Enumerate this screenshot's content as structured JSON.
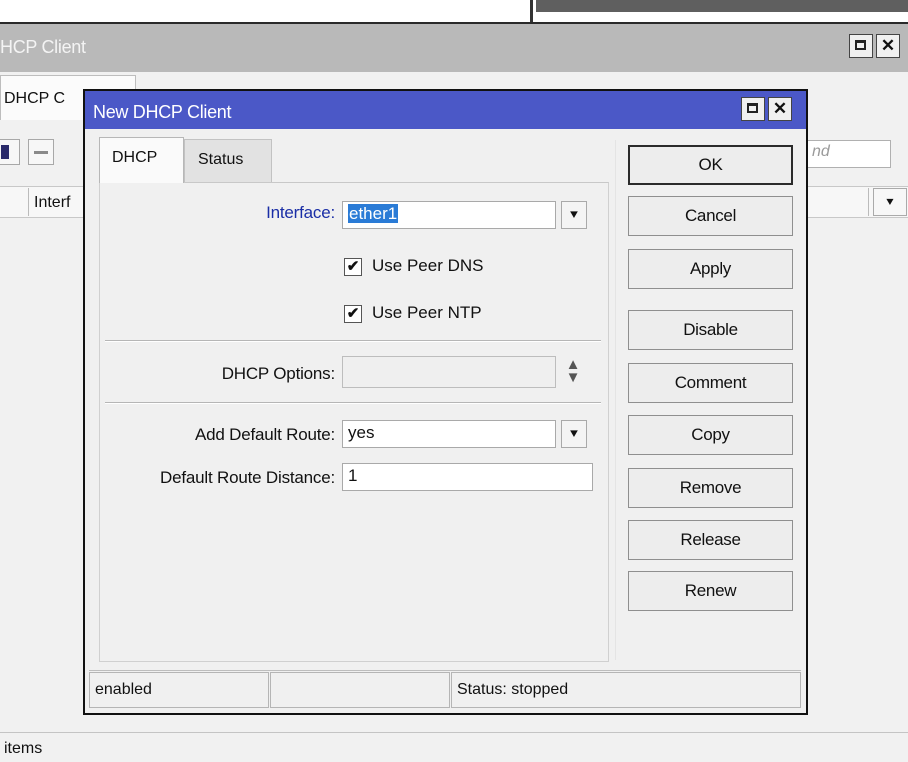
{
  "background_window": {
    "title": "HCP Client",
    "tab_label": "DHCP C",
    "column_header": "Interf",
    "find_placeholder": "nd",
    "column_dropdown_icon": "chevron-down-icon",
    "status_text": "items",
    "toolbar_icons": [
      "add-icon",
      "remove-icon"
    ],
    "window_buttons": [
      "maximize-icon",
      "close-icon"
    ]
  },
  "dialog": {
    "title": "New DHCP Client",
    "title_bar_color": "#4b58c7",
    "tabs": [
      {
        "label": "DHCP",
        "active": true
      },
      {
        "label": "Status",
        "active": false
      }
    ],
    "form": {
      "interface": {
        "label": "Interface:",
        "value": "ether1"
      },
      "use_peer_dns": {
        "label": "Use Peer DNS",
        "checked": true
      },
      "use_peer_ntp": {
        "label": "Use Peer NTP",
        "checked": true
      },
      "dhcp_options": {
        "label": "DHCP Options:",
        "value": ""
      },
      "add_default_route": {
        "label": "Add Default Route:",
        "value": "yes"
      },
      "default_route_distance": {
        "label": "Default Route Distance:",
        "value": "1"
      }
    },
    "buttons": {
      "ok": "OK",
      "cancel": "Cancel",
      "apply": "Apply",
      "disable": "Disable",
      "comment": "Comment",
      "copy": "Copy",
      "remove": "Remove",
      "release": "Release",
      "renew": "Renew"
    },
    "statusbar": {
      "state": "enabled",
      "middle": "",
      "status": "Status: stopped"
    },
    "glyphs": {
      "close": "✕",
      "dropdown": "⯆",
      "check": "✔",
      "spin": "▲▼"
    }
  }
}
